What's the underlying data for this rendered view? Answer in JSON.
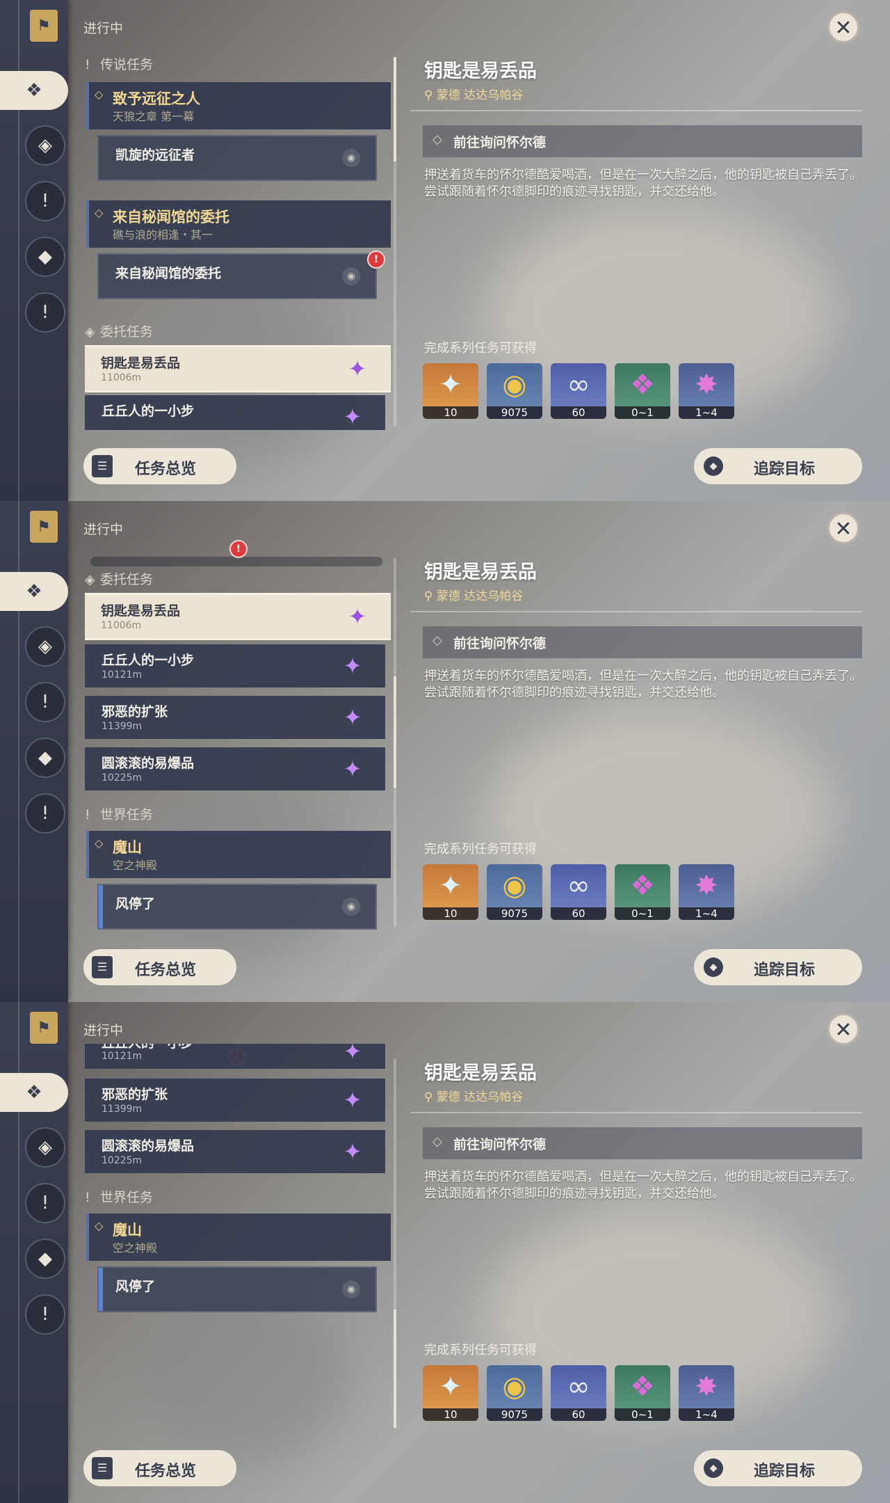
{
  "header": {
    "in_progress": "进行中"
  },
  "sidebar": {
    "icons": [
      "bookmark-icon",
      "all-quests-icon",
      "archon-quest-icon",
      "world-quest-icon",
      "commission-icon",
      "event-quest-icon"
    ]
  },
  "sections": {
    "legend": "传说任务",
    "commission": "委托任务",
    "world": "世界任务"
  },
  "legend_quests": [
    {
      "title": "致予远征之人",
      "subtitle": "天狼之章 第一幕",
      "step": "凯旋的远征者"
    },
    {
      "title": "来自秘闻馆的委托",
      "subtitle": "礁与浪的相逢・其一",
      "step": "来自秘闻馆的委托"
    }
  ],
  "commissions": [
    {
      "title": "钥匙是易丢品",
      "distance": "11006m"
    },
    {
      "title": "丘丘人的一小步",
      "distance": "10121m"
    },
    {
      "title": "邪恶的扩张",
      "distance": "11399m"
    },
    {
      "title": "圆滚滚的易爆品",
      "distance": "10225m"
    }
  ],
  "world_quest": {
    "title": "魔山",
    "subtitle": "空之神殿",
    "step": "风停了"
  },
  "badge": "!",
  "detail": {
    "title": "钥匙是易丢品",
    "location": "蒙德 达达乌帕谷",
    "objective": "前往询问怀尔德",
    "description": "押送着货车的怀尔德酷爱喝酒，但是在一次大醉之后，他的钥匙被自己弄丢了。尝试跟随着怀尔德脚印的痕迹寻找钥匙，并交还给他。",
    "rewards_title": "完成系列任务可获得",
    "rewards": [
      {
        "icon": "primogem-icon",
        "glyph": "✦",
        "count": "10"
      },
      {
        "icon": "mora-icon",
        "glyph": "◉",
        "count": "9075"
      },
      {
        "icon": "companionship-exp-icon",
        "glyph": "∞",
        "count": "60"
      },
      {
        "icon": "enhancement-ore-icon",
        "glyph": "❖",
        "count": "0~1"
      },
      {
        "icon": "crystal-chunk-icon",
        "glyph": "✸",
        "count": "1~4"
      }
    ]
  },
  "buttons": {
    "overview": "任务总览",
    "track": "追踪目标"
  }
}
